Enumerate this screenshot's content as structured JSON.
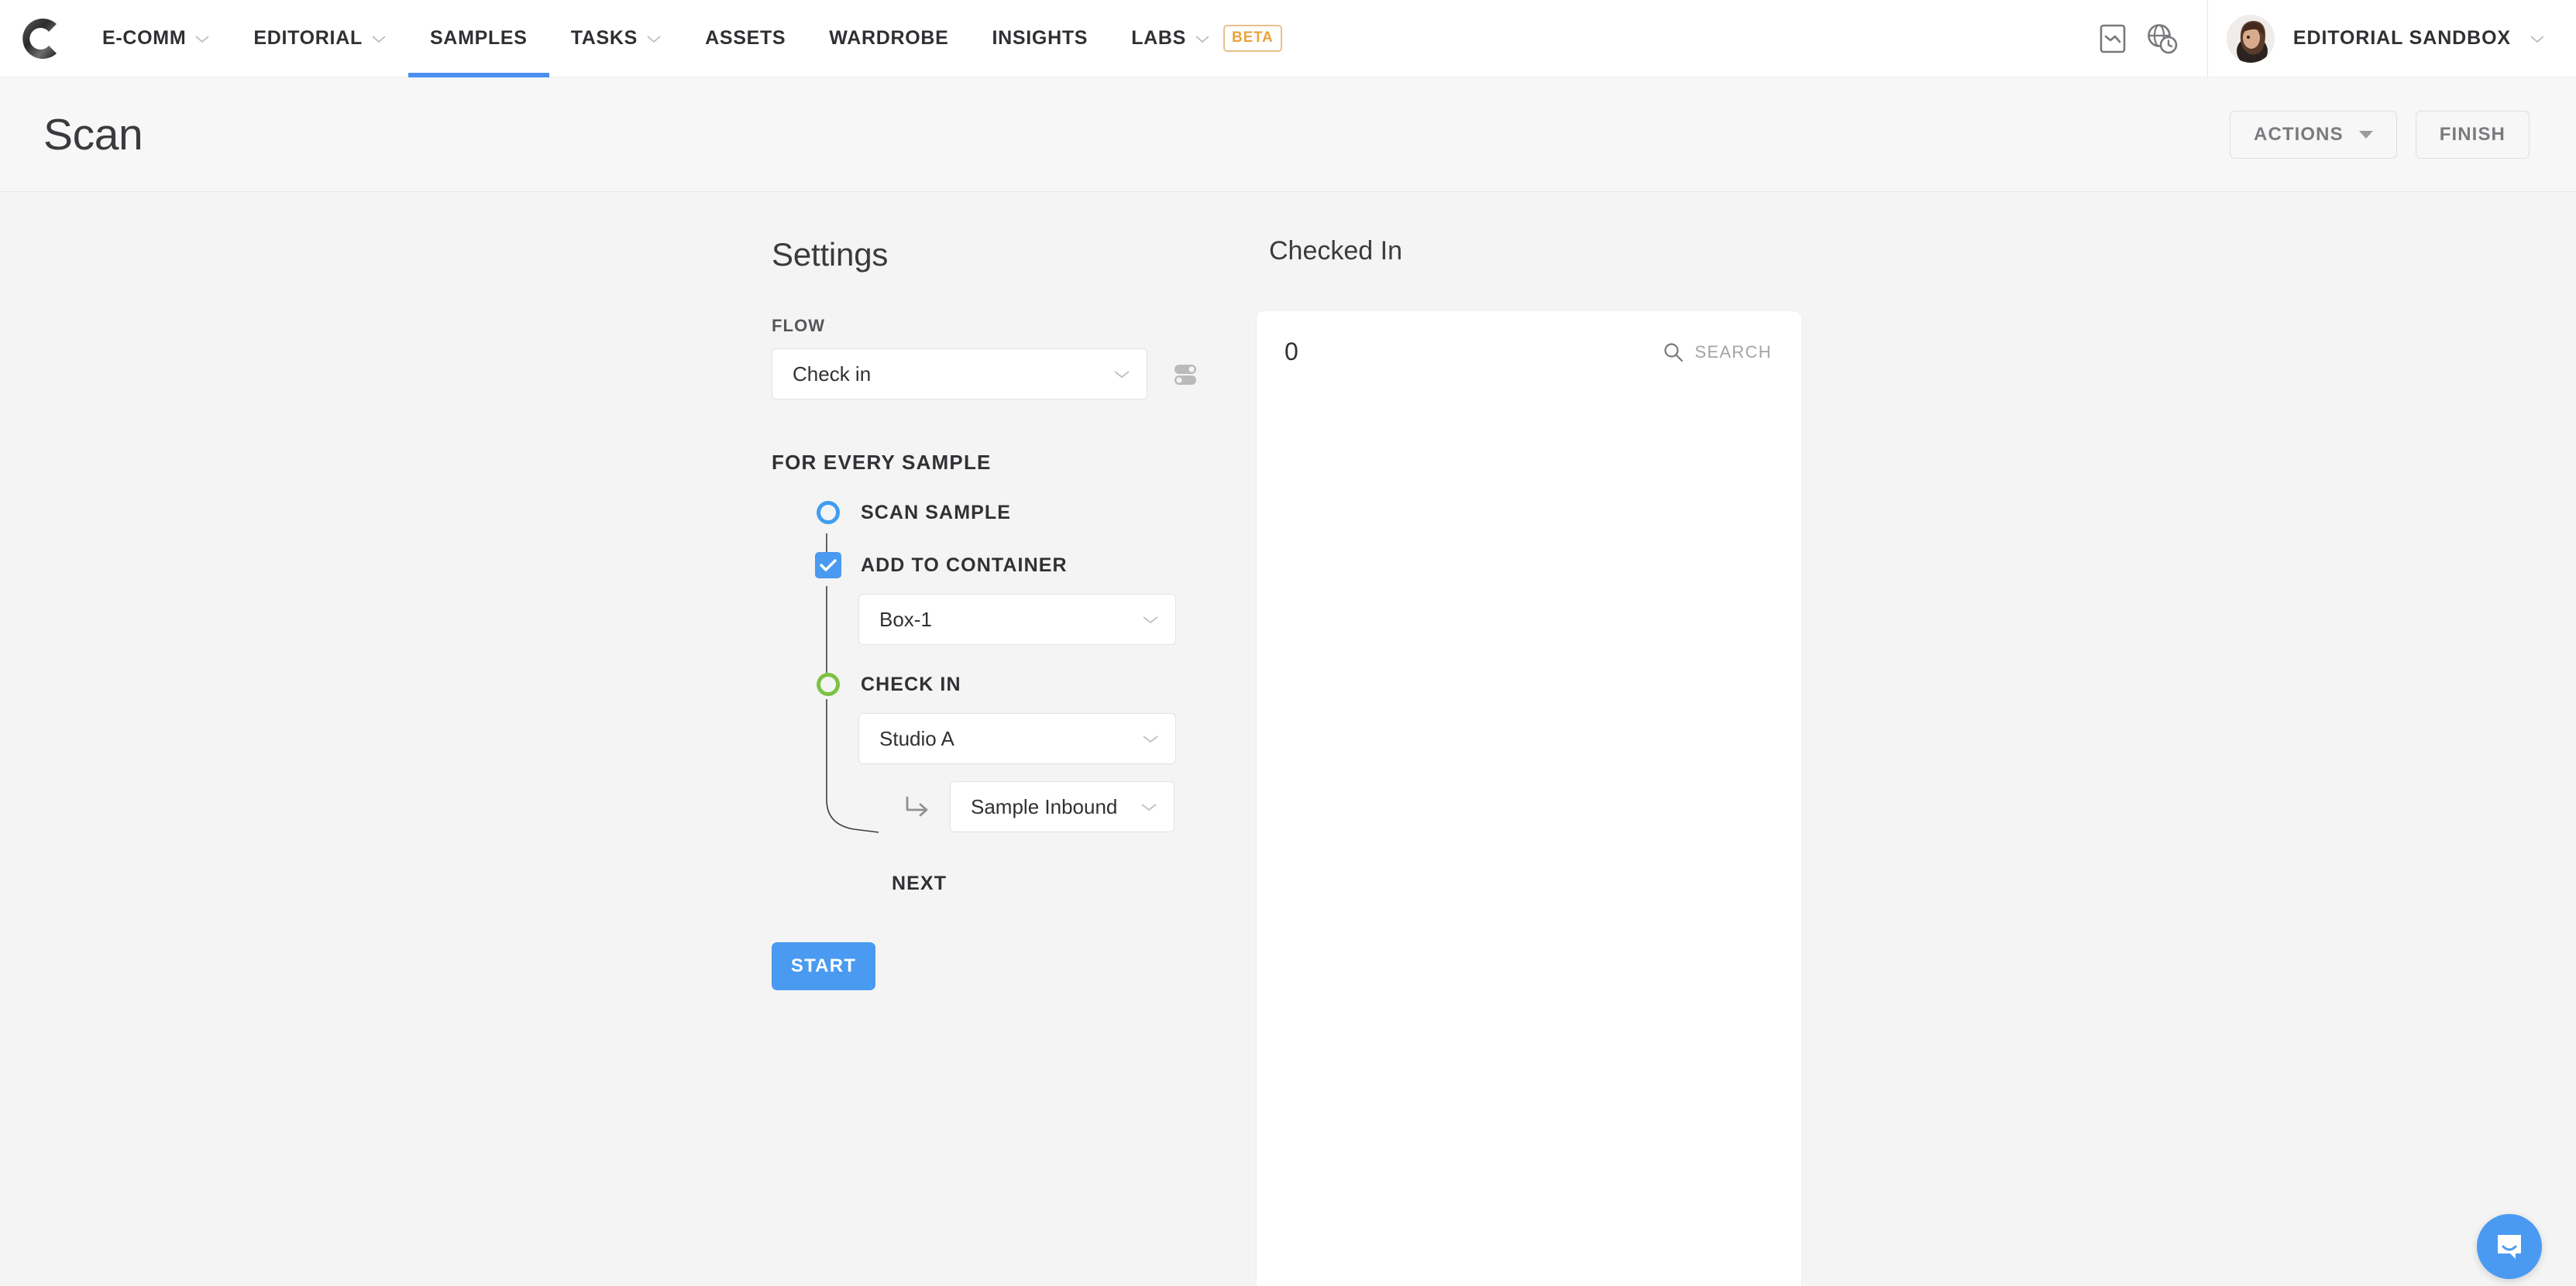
{
  "app": {
    "logo_icon": "brand-c-logo",
    "accent_blue": "#4a9af1",
    "accent_green": "#7dc242",
    "accent_orange": "#e8a33d"
  },
  "topnav": {
    "items": [
      {
        "label": "E-COMM",
        "has_chevron": true,
        "active": false,
        "badge": null
      },
      {
        "label": "EDITORIAL",
        "has_chevron": true,
        "active": false,
        "badge": null
      },
      {
        "label": "SAMPLES",
        "has_chevron": false,
        "active": true,
        "badge": null
      },
      {
        "label": "TASKS",
        "has_chevron": true,
        "active": false,
        "badge": null
      },
      {
        "label": "ASSETS",
        "has_chevron": false,
        "active": false,
        "badge": null
      },
      {
        "label": "WARDROBE",
        "has_chevron": false,
        "active": false,
        "badge": null
      },
      {
        "label": "INSIGHTS",
        "has_chevron": false,
        "active": false,
        "badge": null
      },
      {
        "label": "LABS",
        "has_chevron": true,
        "active": false,
        "badge": "BETA"
      }
    ],
    "right_icons": [
      "report-icon",
      "globe-clock-icon"
    ],
    "account": {
      "name": "EDITORIAL SANDBOX",
      "avatar_icon": "user-avatar"
    }
  },
  "page_header": {
    "title": "Scan",
    "actions_button": "ACTIONS",
    "finish_button": "FINISH"
  },
  "settings": {
    "title": "Settings",
    "flow_label": "FLOW",
    "flow_value": "Check in",
    "toggles_icon": "sliders-toggle-icon",
    "section_label": "FOR EVERY SAMPLE",
    "steps": [
      {
        "marker": "ring-blue",
        "label": "SCAN SAMPLE",
        "select": null,
        "sub_select": null
      },
      {
        "marker": "checkbox-checked",
        "label": "ADD TO CONTAINER",
        "select": "Box-1",
        "sub_select": null
      },
      {
        "marker": "ring-green",
        "label": "CHECK IN",
        "select": "Studio A",
        "sub_select": "Sample Inbound",
        "sub_icon": "arrow-turn-down-right-icon"
      }
    ],
    "next_label": "NEXT",
    "start_button": "START"
  },
  "checked_in": {
    "title": "Checked In",
    "count": "0",
    "search_label": "SEARCH",
    "search_icon": "search-icon"
  },
  "support": {
    "chat_icon": "intercom-chat-icon"
  }
}
